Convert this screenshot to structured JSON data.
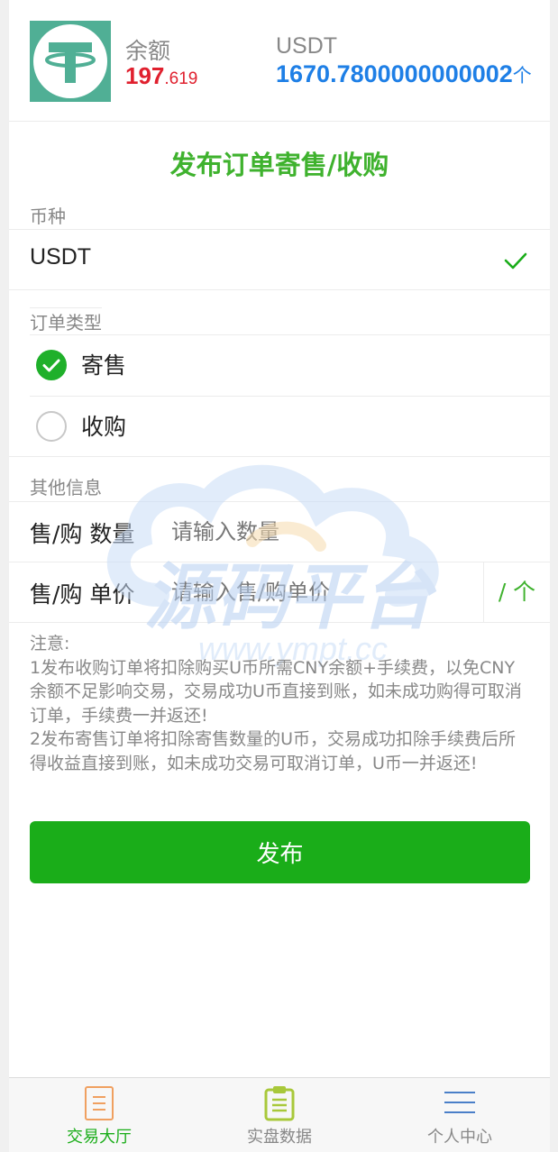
{
  "header": {
    "balance_label": "余额",
    "balance_int": "197",
    "balance_dec": ".619",
    "usdt_label": "USDT",
    "usdt_value": "1670.7800000000002",
    "usdt_unit": "个"
  },
  "form": {
    "title": "发布订单寄售/收购",
    "coin_section_label": "币种",
    "coin_selected": "USDT",
    "type_section_label": "订单类型",
    "type_options": [
      {
        "label": "寄售",
        "checked": true
      },
      {
        "label": "收购",
        "checked": false
      }
    ],
    "other_section_label": "其他信息",
    "quantity_label": "售/购 数量",
    "quantity_placeholder": "请输入数量",
    "quantity_value": "",
    "price_label": "售/购 单价",
    "price_placeholder": "请输入售/购单价",
    "price_value": "",
    "price_unit": "/ 个",
    "notes": [
      "注意:",
      "1发布收购订单将扣除购买U币所需CNY余额+手续费，以免CNY余额不足影响交易，交易成功U币直接到账，如未成功购得可取消订单，手续费一并返还!",
      "2发布寄售订单将扣除寄售数量的U币，交易成功扣除手续费后所得收益直接到账，如未成功交易可取消订单，U币一并返还!"
    ],
    "submit_label": "发布"
  },
  "watermark": {
    "text": "源码平台",
    "url": "www.ympt.cc"
  },
  "tabbar": {
    "items": [
      {
        "label": "交易大厅",
        "icon": "document-icon",
        "active": true
      },
      {
        "label": "实盘数据",
        "icon": "clipboard-icon",
        "active": false
      },
      {
        "label": "个人中心",
        "icon": "menu-icon",
        "active": false
      }
    ]
  },
  "colors": {
    "accent_green": "#1aad19",
    "title_green": "#3fb22e",
    "balance_red": "#e0202e",
    "usdt_blue": "#1e7fe6",
    "tether_teal": "#50af95"
  }
}
